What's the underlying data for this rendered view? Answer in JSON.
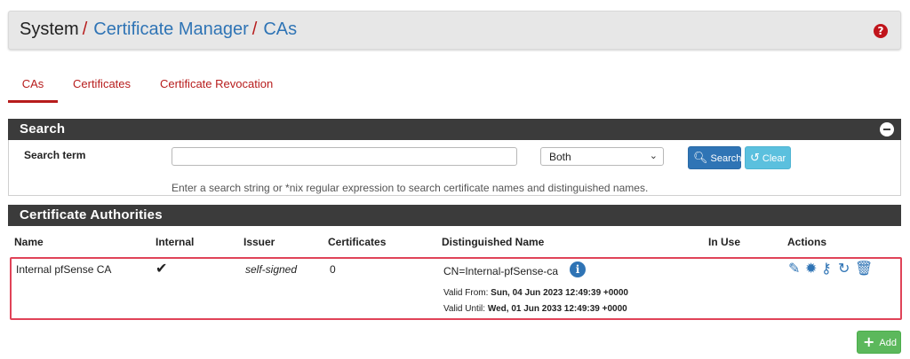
{
  "breadcrumb": {
    "root": "System",
    "separator": "/",
    "items": [
      "Certificate Manager",
      "CAs"
    ]
  },
  "help_icon": "?",
  "tabs": [
    {
      "label": "CAs",
      "active": true
    },
    {
      "label": "Certificates",
      "active": false
    },
    {
      "label": "Certificate Revocation",
      "active": false
    }
  ],
  "search_panel": {
    "title": "Search",
    "label": "Search term",
    "input_value": "",
    "select_value": "Both",
    "search_button": "Search",
    "clear_button": "Clear",
    "help_text": "Enter a search string or *nix regular expression to search certificate names and distinguished names."
  },
  "ca_panel": {
    "title": "Certificate Authorities",
    "columns": [
      "Name",
      "Internal",
      "Issuer",
      "Certificates",
      "Distinguished Name",
      "In Use",
      "Actions"
    ],
    "rows": [
      {
        "name": "Internal pfSense CA",
        "internal": true,
        "issuer": "self-signed",
        "certificates": "0",
        "dn": "CN=Internal-pfSense-ca",
        "valid_from_label": "Valid From:",
        "valid_from": "Sun, 04 Jun 2023 12:49:39 +0000",
        "valid_until_label": "Valid Until:",
        "valid_until": "Wed, 01 Jun 2033 12:49:39 +0000",
        "in_use": "",
        "actions": [
          "pencil-icon",
          "gear-icon",
          "key-icon",
          "refresh-icon",
          "trash-icon"
        ]
      }
    ]
  },
  "add_button": "Add",
  "colors": {
    "accent_red": "#b71c1c",
    "link_blue": "#2f74b5",
    "panel_header": "#3b3b3b",
    "highlight_border": "#e04358",
    "add_green": "#5cb85c"
  }
}
